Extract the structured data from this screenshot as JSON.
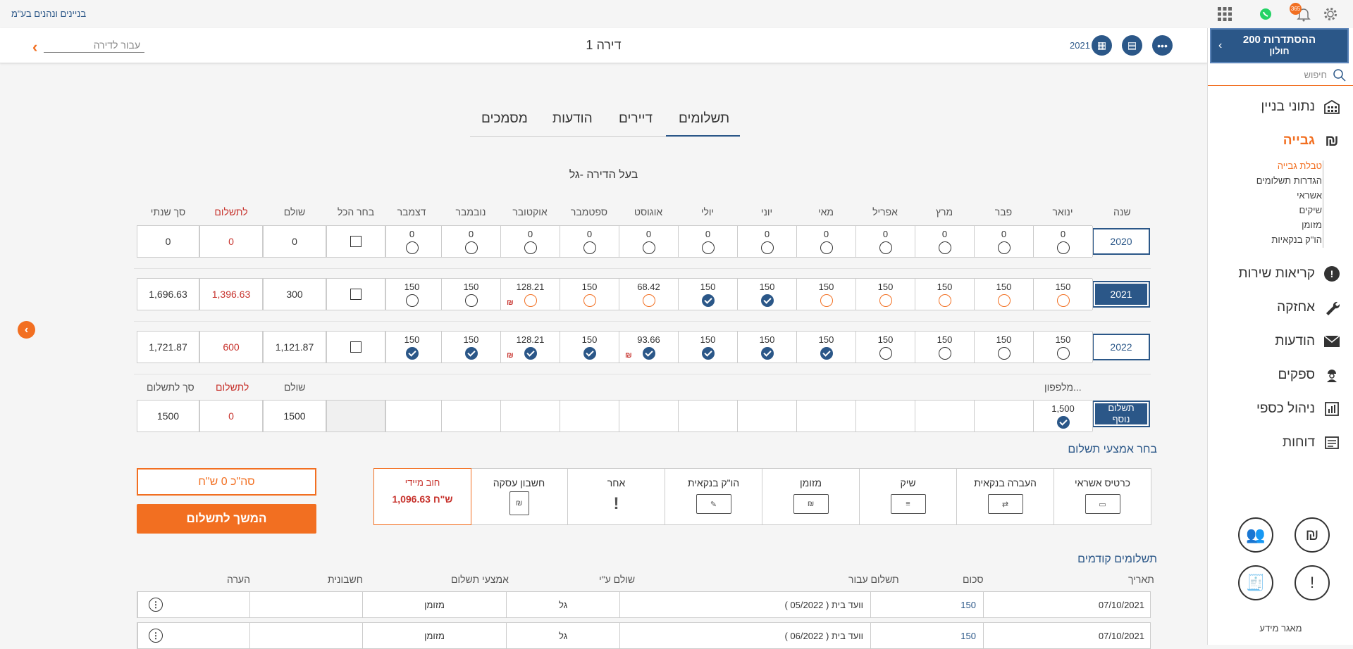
{
  "app": {
    "brand": "בניינים ונהנים בע\"מ",
    "notif_count": "365"
  },
  "header": {
    "title": "דירה 1",
    "jump_placeholder": "עבור לדירה",
    "year": "2021"
  },
  "sidebar": {
    "building_name": "ההסתדרות 200",
    "building_city": "חולון",
    "search_placeholder": "חיפוש",
    "items": [
      {
        "label": "נתוני בניין",
        "icon": "building-icon"
      },
      {
        "label": "גבייה",
        "icon": "shekel-icon"
      },
      {
        "label": "קריאות שירות",
        "icon": "alert-icon"
      },
      {
        "label": "אחזקה",
        "icon": "wrench-icon"
      },
      {
        "label": "הודעות",
        "icon": "envelope-icon"
      },
      {
        "label": "ספקים",
        "icon": "worker-icon"
      },
      {
        "label": "ניהול כספי",
        "icon": "finance-icon"
      },
      {
        "label": "דוחות",
        "icon": "reports-icon"
      }
    ],
    "subitems": [
      "טבלת גבייה",
      "הגדרות תשלומים",
      "אשראי",
      "שיקים",
      "מזומן",
      "הו\"ק בנקאיות"
    ],
    "knowledge": "מאגר מידע"
  },
  "tabs": [
    "תשלומים",
    "דיירים",
    "הודעות",
    "מסמכים"
  ],
  "owner_label": "בעל הדירה -גל",
  "table": {
    "headers": {
      "year": "שנה",
      "select_all": "בחר הכל",
      "paid": "שולם",
      "to_pay": "לתשלום",
      "annual_total": "סך שנתי"
    },
    "months": [
      "ינואר",
      "פבר",
      "מרץ",
      "אפריל",
      "מאי",
      "יוני",
      "יולי",
      "אוגוסט",
      "ספטמבר",
      "אוקטובר",
      "נובמבר",
      "דצמבר"
    ],
    "rows": [
      {
        "year": "2020",
        "values": [
          "0",
          "0",
          "0",
          "0",
          "0",
          "0",
          "0",
          "0",
          "0",
          "0",
          "0",
          "0"
        ],
        "paid": "0",
        "to_pay": "0",
        "annual": "0"
      },
      {
        "year": "2021",
        "values": [
          "150",
          "150",
          "150",
          "150",
          "150",
          "150",
          "150",
          "68.42",
          "150",
          "128.21",
          "150",
          "150"
        ],
        "paid": "300",
        "to_pay": "1,396.63",
        "annual": "1,696.63"
      },
      {
        "year": "2022",
        "values": [
          "150",
          "150",
          "150",
          "150",
          "150",
          "150",
          "150",
          "93.66",
          "150",
          "128.21",
          "150",
          "150"
        ],
        "paid": "1,121.87",
        "to_pay": "600",
        "annual": "1,721.87"
      }
    ],
    "extra": {
      "label1": "תשלום",
      "label2": "נוסף",
      "from_phone": "מלפפון...",
      "value": "1,500",
      "h_paid": "שולם",
      "h_to_pay": "לתשלום",
      "h_total": "סך לתשלום",
      "paid": "1500",
      "to_pay": "0",
      "total": "1500"
    }
  },
  "payment_methods": {
    "title": "בחר אמצעי תשלום",
    "items": [
      "כרטיס אשראי",
      "העברה בנקאית",
      "שיק",
      "מזומן",
      "הו\"ק בנקאית",
      "אחר",
      "חשבון עסקה"
    ],
    "debt_label": "חוב מיידי",
    "debt_value": "1,096.63 ש\"ח",
    "total": "סה\"כ 0 ש\"ח",
    "continue": "המשך לתשלום"
  },
  "previous": {
    "title": "תשלומים קודמים",
    "headers": [
      "תאריך",
      "סכום",
      "תשלום עבור",
      "שולם ע\"י",
      "אמצעי תשלום",
      "חשבונית",
      "הערה"
    ],
    "rows": [
      {
        "date": "07/10/2021",
        "amount": "150",
        "for": "וועד בית ( 05/2022 )",
        "by": "גל",
        "method": "מזומן"
      },
      {
        "date": "07/10/2021",
        "amount": "150",
        "for": "וועד בית ( 06/2022 )",
        "by": "גל",
        "method": "מזומן"
      }
    ]
  }
}
